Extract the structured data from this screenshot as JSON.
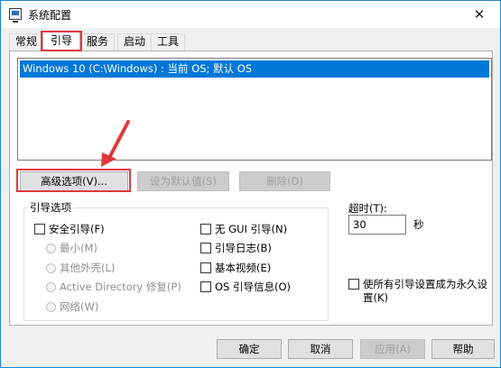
{
  "window": {
    "title": "系统配置",
    "icon": "msconfig-icon",
    "accent_border": "#1883d7"
  },
  "tabs": [
    {
      "label": "常规"
    },
    {
      "label": "引导",
      "active": true
    },
    {
      "label": "服务"
    },
    {
      "label": "启动"
    },
    {
      "label": "工具"
    }
  ],
  "os_list": {
    "items": [
      "Windows 10 (C:\\Windows) : 当前 OS; 默认 OS"
    ],
    "selected_color": "#0078d7"
  },
  "list_buttons": {
    "advanced": "高级选项(V)...",
    "set_default": "设为默认值(S)",
    "delete": "删除(D)"
  },
  "boot_options": {
    "legend": "引导选项",
    "safe_boot": "安全引导(F)",
    "minimal": "最小(M)",
    "alternate_shell": "其他外壳(L)",
    "active_directory": "Active Directory 修复(P)",
    "network": "网络(W)",
    "no_gui": "无 GUI 引导(N)",
    "boot_log": "引导日志(B)",
    "base_video": "基本视频(E)",
    "os_boot_info": "OS 引导信息(O)"
  },
  "timeout": {
    "label": "超时(T):",
    "value": "30",
    "unit": "秒"
  },
  "permanent": {
    "label": "使所有引导设置成为永久设置(K)"
  },
  "footer_buttons": {
    "ok": "确定",
    "cancel": "取消",
    "apply": "应用(A)",
    "help": "帮助"
  },
  "annotation": {
    "highlight_color": "#e0393e"
  }
}
